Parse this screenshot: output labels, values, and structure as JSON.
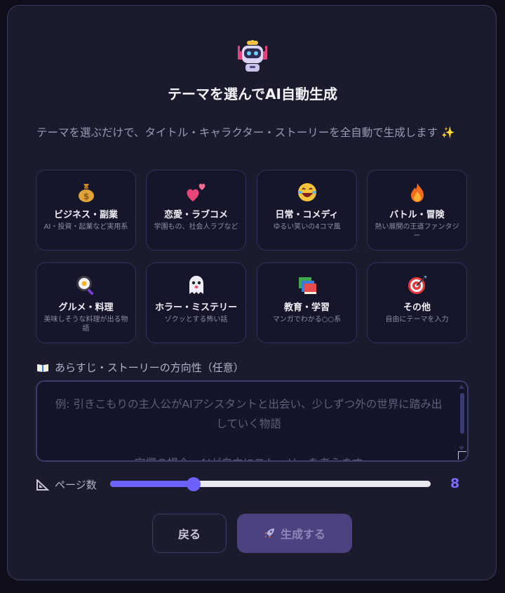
{
  "header": {
    "title": "テーマを選んでAI自動生成",
    "description": "テーマを選ぶだけで、タイトル・キャラクター・ストーリーを全自動で生成します ✨"
  },
  "themes": [
    {
      "icon": "money-bag",
      "name": "ビジネス・副業",
      "sub": "AI・投資・起業など実用系"
    },
    {
      "icon": "two-hearts",
      "name": "恋愛・ラブコメ",
      "sub": "学園もの、社会人ラブなど"
    },
    {
      "icon": "laughing-face",
      "name": "日常・コメディ",
      "sub": "ゆるい笑いの4コマ風"
    },
    {
      "icon": "fire",
      "name": "バトル・冒険",
      "sub": "熱い展開の王道ファンタジー"
    },
    {
      "icon": "frying-pan",
      "name": "グルメ・料理",
      "sub": "美味しそうな料理が出る物語"
    },
    {
      "icon": "ghost",
      "name": "ホラー・ミステリー",
      "sub": "ゾクッとする怖い話"
    },
    {
      "icon": "books",
      "name": "教育・学習",
      "sub": "マンガでわかる○○系"
    },
    {
      "icon": "target",
      "name": "その他",
      "sub": "自由にテーマを入力"
    }
  ],
  "synopsis": {
    "label": "あらすじ・ストーリーの方向性（任意）",
    "icon": "open-book",
    "placeholder": "例: 引きこもりの主人公がAIアシスタントと出会い、少しずつ外の世界に踏み出していく物語\n\n空欄の場合、AIが自由にストーリーを考えます"
  },
  "pages": {
    "label": "ページ数",
    "icon": "triangular-ruler",
    "value": "8",
    "min": 4,
    "max": 20
  },
  "actions": {
    "back": "戻る",
    "generate": "生成する",
    "generate_icon": "rocket"
  },
  "colors": {
    "accent": "#6c63ff",
    "panel": "#1b1b2e",
    "background": "#0f0f1b"
  }
}
